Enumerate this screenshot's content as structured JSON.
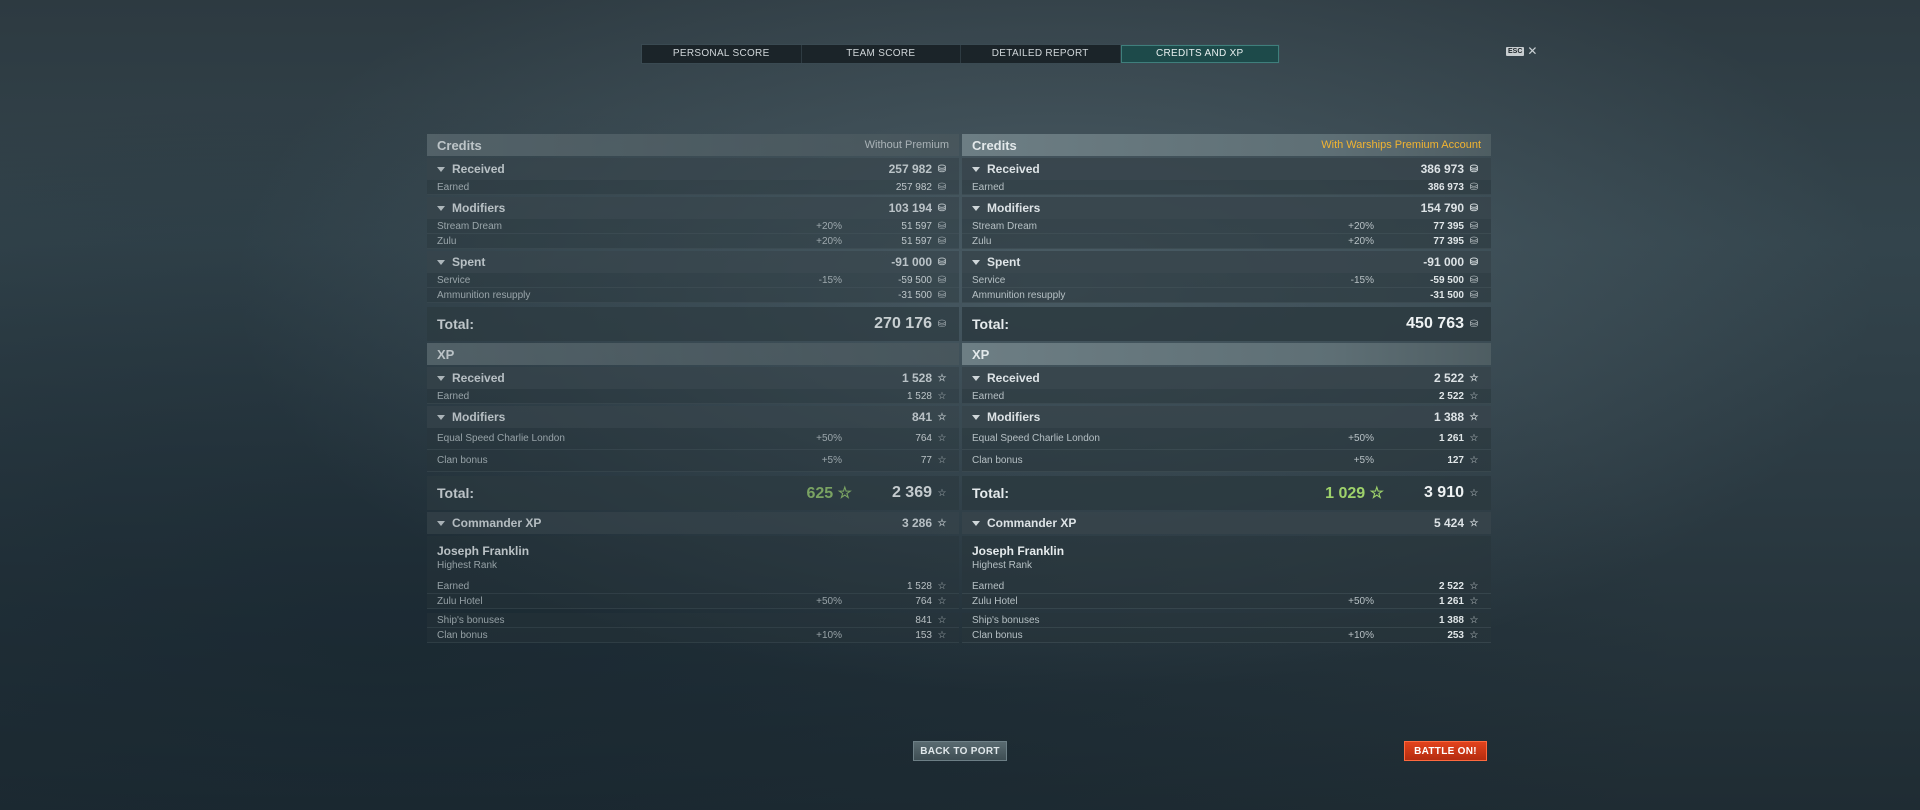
{
  "tabs": [
    {
      "label": "PERSONAL SCORE"
    },
    {
      "label": "TEAM SCORE"
    },
    {
      "label": "DETAILED REPORT"
    },
    {
      "label": "CREDITS AND XP"
    }
  ],
  "esc": {
    "key": "ESC",
    "close": "✕"
  },
  "left": {
    "credits_title": "Credits",
    "credits_note": "Without Premium",
    "received": {
      "label": "Received",
      "value": "257 982"
    },
    "earned": {
      "label": "Earned",
      "value": "257 982"
    },
    "modifiers": {
      "label": "Modifiers",
      "value": "103 194"
    },
    "mods": [
      {
        "label": "Stream Dream",
        "pct": "+20%",
        "value": "51 597"
      },
      {
        "label": "Zulu",
        "pct": "+20%",
        "value": "51 597"
      }
    ],
    "spent": {
      "label": "Spent",
      "value": "-91 000"
    },
    "spent_items": [
      {
        "label": "Service",
        "pct": "-15%",
        "value": "-59 500"
      },
      {
        "label": "Ammunition resupply",
        "pct": "",
        "value": "-31 500"
      }
    ],
    "credits_total": {
      "label": "Total:",
      "value": "270 176"
    },
    "xp_title": "XP",
    "xp_received": {
      "label": "Received",
      "value": "1 528"
    },
    "xp_earned": {
      "label": "Earned",
      "value": "1 528"
    },
    "xp_modifiers": {
      "label": "Modifiers",
      "value": "841"
    },
    "xp_mods": [
      {
        "label": "Equal Speed Charlie London",
        "pct": "+50%",
        "value": "764"
      },
      {
        "label": "Clan bonus",
        "pct": "+5%",
        "value": "77"
      }
    ],
    "xp_total": {
      "label": "Total:",
      "gain": "625",
      "value": "2 369"
    },
    "commander": {
      "label": "Commander XP",
      "value": "3 286"
    },
    "person": {
      "name": "Joseph Franklin",
      "rank": "Highest Rank"
    },
    "cmd_rows": [
      {
        "label": "Earned",
        "pct": "",
        "value": "1 528"
      },
      {
        "label": "Zulu Hotel",
        "pct": "+50%",
        "value": "764"
      }
    ],
    "cmd_rows2": [
      {
        "label": "Ship's bonuses",
        "pct": "",
        "value": "841"
      },
      {
        "label": "Clan bonus",
        "pct": "+10%",
        "value": "153"
      }
    ]
  },
  "right": {
    "credits_title": "Credits",
    "credits_note": "With Warships Premium Account",
    "received": {
      "label": "Received",
      "value": "386 973"
    },
    "earned": {
      "label": "Earned",
      "value": "386 973"
    },
    "modifiers": {
      "label": "Modifiers",
      "value": "154 790"
    },
    "mods": [
      {
        "label": "Stream Dream",
        "pct": "+20%",
        "value": "77 395"
      },
      {
        "label": "Zulu",
        "pct": "+20%",
        "value": "77 395"
      }
    ],
    "spent": {
      "label": "Spent",
      "value": "-91 000"
    },
    "spent_items": [
      {
        "label": "Service",
        "pct": "-15%",
        "value": "-59 500"
      },
      {
        "label": "Ammunition resupply",
        "pct": "",
        "value": "-31 500"
      }
    ],
    "credits_total": {
      "label": "Total:",
      "value": "450 763"
    },
    "xp_title": "XP",
    "xp_received": {
      "label": "Received",
      "value": "2 522"
    },
    "xp_earned": {
      "label": "Earned",
      "value": "2 522"
    },
    "xp_modifiers": {
      "label": "Modifiers",
      "value": "1 388"
    },
    "xp_mods": [
      {
        "label": "Equal Speed Charlie London",
        "pct": "+50%",
        "value": "1 261"
      },
      {
        "label": "Clan bonus",
        "pct": "+5%",
        "value": "127"
      }
    ],
    "xp_total": {
      "label": "Total:",
      "gain": "1 029",
      "value": "3 910"
    },
    "commander": {
      "label": "Commander XP",
      "value": "5 424"
    },
    "person": {
      "name": "Joseph Franklin",
      "rank": "Highest Rank"
    },
    "cmd_rows": [
      {
        "label": "Earned",
        "pct": "",
        "value": "2 522"
      },
      {
        "label": "Zulu Hotel",
        "pct": "+50%",
        "value": "1 261"
      }
    ],
    "cmd_rows2": [
      {
        "label": "Ship's bonuses",
        "pct": "",
        "value": "1 388"
      },
      {
        "label": "Clan bonus",
        "pct": "+10%",
        "value": "253"
      }
    ]
  },
  "icons": {
    "credit": "credit-icon",
    "xp": "star-icon"
  },
  "buttons": {
    "back": "BACK TO PORT",
    "battle": "BATTLE ON!"
  }
}
